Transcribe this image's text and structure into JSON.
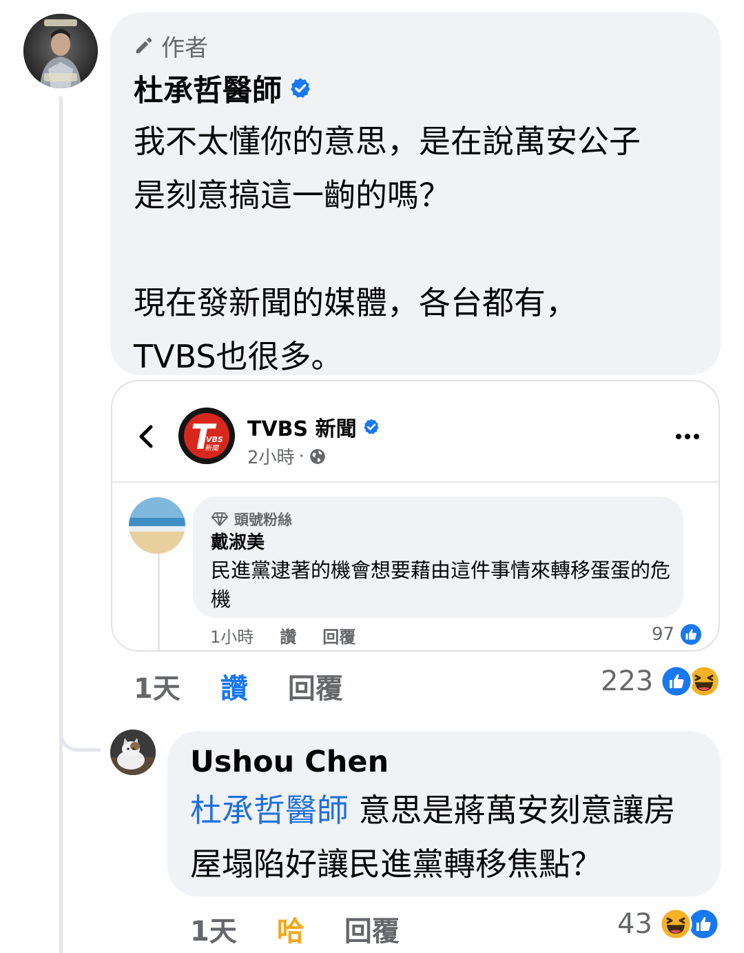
{
  "comment": {
    "author_badge": "作者",
    "name": "杜承哲醫師",
    "text": "我不太懂你的意思，是在說萬安公子\n是刻意搞這一齣的嗎？\n\n現在發新聞的媒體，各台都有，\nTVBS也很多。",
    "time": "1天",
    "like_label": "讚",
    "reply_label": "回覆",
    "reaction_count": "223",
    "reactions": [
      "like-icon",
      "haha-icon"
    ]
  },
  "embed": {
    "page_name": "TVBS 新聞",
    "post_time": "2小時",
    "logo_text": "T",
    "logo_sub": "VBS 新聞",
    "reply": {
      "badge": "頭號粉絲",
      "name": "戴淑美",
      "text": "民進黨逮著的機會想要藉由這件事情來轉移蛋蛋的危機",
      "time": "1小時",
      "like_label": "讚",
      "reply_label": "回覆",
      "reaction_count": "97"
    }
  },
  "reply": {
    "name": "Ushou Chen",
    "mention": "杜承哲醫師",
    "text": " 意思是蔣萬安刻意讓房屋塌陷好讓民進黨轉移焦點？",
    "time": "1天",
    "reaction_label": "哈",
    "reply_label": "回覆",
    "reaction_count": "43",
    "reactions": [
      "haha-icon",
      "like-icon"
    ]
  },
  "colors": {
    "bubble": "#f0f2f5",
    "secondary_text": "#65676b",
    "like_blue": "#1877f2",
    "mention_blue": "#216fdb",
    "haha_yellow": "#f7b125",
    "verified": "#1877f2"
  }
}
